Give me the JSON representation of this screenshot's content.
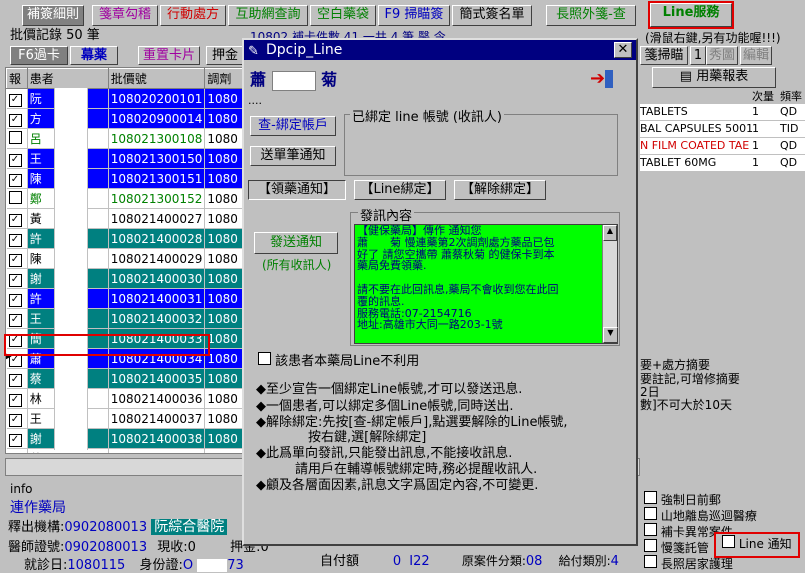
{
  "toolbar": {
    "b1": "補簽細則",
    "b2": "箋章勾稽",
    "b3": "行動處方",
    "b4": "互助網查詢",
    "b5": "空白藥袋",
    "b6": "F9 掃瞄簽",
    "b7": "簡式簽名單",
    "b8": "長照外箋-查",
    "b9": "Line服務"
  },
  "header": {
    "count_label": "批價記錄 50 筆",
    "top_clipped": "10802 補卡件數 41 一共 4 筆 醫 令"
  },
  "tabs": {
    "f6": "F6過卡",
    "sputum": "幕薬",
    "reprint": "重置卡片",
    "deposit": "押金"
  },
  "grid": {
    "columns": [
      "報",
      "患者",
      "批價號",
      "調劑"
    ],
    "rows": [
      {
        "name": "阮",
        "id": "108020200101",
        "adj": "1080",
        "style": "blue",
        "checked": "✓",
        "marker": ""
      },
      {
        "name": "方",
        "id": "108020900014",
        "adj": "1080",
        "style": "blue",
        "checked": "✓",
        "marker": ""
      },
      {
        "name": "呂　　水",
        "id": "108021300108",
        "adj": "1080",
        "style": "green",
        "checked": "",
        "marker": ""
      },
      {
        "name": "王",
        "id": "108021300150",
        "adj": "1080",
        "style": "blue",
        "checked": "✓",
        "marker": ""
      },
      {
        "name": "陳　　珠",
        "id": "108021300151",
        "adj": "1080",
        "style": "blue",
        "checked": "✓",
        "marker": ""
      },
      {
        "name": "鄭",
        "id": "108021300152",
        "adj": "1080",
        "style": "green",
        "checked": "",
        "marker": ""
      },
      {
        "name": "黃",
        "id": "108021400027",
        "adj": "1080",
        "style": "plain",
        "checked": "✓",
        "marker": ""
      },
      {
        "name": "許　　錦",
        "id": "108021400028",
        "adj": "1080",
        "style": "teal",
        "checked": "✓",
        "marker": ""
      },
      {
        "name": "陳",
        "id": "108021400029",
        "adj": "1080",
        "style": "plain",
        "checked": "✓",
        "marker": ""
      },
      {
        "name": "謝",
        "id": "108021400030",
        "adj": "1080",
        "style": "teal",
        "checked": "✓",
        "marker": ""
      },
      {
        "name": "許",
        "id": "108021400031",
        "adj": "1080",
        "style": "blue",
        "checked": "✓",
        "marker": ""
      },
      {
        "name": "王",
        "id": "108021400032",
        "adj": "1080",
        "style": "teal",
        "checked": "✓",
        "marker": ""
      },
      {
        "name": "簡",
        "id": "108021400033",
        "adj": "1080",
        "style": "teal",
        "checked": "✓",
        "marker": ""
      },
      {
        "name": "蕭　　菊",
        "id": "108021400034",
        "adj": "1080",
        "style": "blue",
        "checked": "✓",
        "marker": "▶"
      },
      {
        "name": "蔡",
        "id": "108021400035",
        "adj": "1080",
        "style": "teal",
        "checked": "✓",
        "marker": ""
      },
      {
        "name": "林",
        "id": "108021400036",
        "adj": "1080",
        "style": "plain",
        "checked": "✓",
        "marker": ""
      },
      {
        "name": "王",
        "id": "108021400037",
        "adj": "1080",
        "style": "plain",
        "checked": "✓",
        "marker": ""
      },
      {
        "name": "謝",
        "id": "108021400038",
        "adj": "1080",
        "style": "teal",
        "checked": "✓",
        "marker": ""
      },
      {
        "name": "黃",
        "id": "108021400039",
        "adj": "1080",
        "style": "plain",
        "checked": "✓",
        "marker": ""
      }
    ]
  },
  "dialog": {
    "title": "Dpcip_Line",
    "patient_surname": "蕭",
    "patient_given": "菊",
    "dots": "....",
    "bound_group": "已綁定 line 帳號 (收訊人)",
    "query_btn": "查-綁定帳戶",
    "send_each_btn": "送單筆通知",
    "tab_notify": "【領藥通知】",
    "tab_bind": "【Line綁定】",
    "tab_unbind": "【解除綁定】",
    "msg_group": "發訊內容",
    "send_btn": "發送通知",
    "send_sub": "(所有收訊人)",
    "msg_lines": [
      "【健保藥局】傳作 通知您",
      "蕭　　菊 慢連藥第2次調劑處方藥品已包",
      "好了 請您空攜帶 蕭蔡秋菊 的健保卡到本",
      "藥局免費領藥.",
      "",
      "請不要在此回訊息,藥局不會收到您在此回",
      "覆的訊息.",
      "服務電話:07-2154716",
      "地址:高雄市大同一路203-1號"
    ],
    "no_line_label": "該患者本藥局Line不利用",
    "notes": [
      "◆至少宣告一個綁定Line帳號,才可以發送迅息.",
      "◆一個患者,可以綁定多個Line帳號,同時送出.",
      "◆解除綁定:先按[查-綁定帳戶],點選要解除的Line帳號,",
      "　　　　按右鍵,選[解除綁定]",
      "◆此爲單向發訊,只能發出訊息,不能接收訊息.",
      "　　　請用戶在輔導帳號綁定時,務必提醒收訊人.",
      "◆顧及各層面因素,訊息文字爲固定內容,不可變更."
    ]
  },
  "right": {
    "hint": "(滑鼠右鍵,另有功能喔!!!)",
    "btn_scan": "箋掃瞄",
    "btn_1": "1",
    "btn_redo": "秀圖",
    "btn_edit": "編輯",
    "btn_report": "用藥報表",
    "col_qty": "次量",
    "col_freq": "頻率",
    "meds": [
      {
        "name": "TABLETS",
        "qty": "1",
        "freq": "QD"
      },
      {
        "name": "BAL CAPSULES 5001",
        "qty": "1",
        "freq": "TID"
      },
      {
        "name": "N FILM COATED TAE",
        "qty": "1",
        "freq": "QD"
      },
      {
        "name": "TABLET 60MG",
        "qty": "1",
        "freq": "QD"
      }
    ],
    "note1": "要+處方摘要",
    "note2": "要註記,可增修摘要",
    "note3": "2日",
    "note4": "數]不可大於10天",
    "chk1": "強制日前郵",
    "chk2": "山地離島巡迴醫療",
    "chk3": "補卡異常案件",
    "chk4": "慢箋託管",
    "chk5": "長照居家護理",
    "line_notify": "Line 通知"
  },
  "bottom": {
    "info": "info",
    "pharmacy": "連作藥局",
    "inst_label": "釋出機構:",
    "inst_code": "0902080013",
    "inst_name": "阮綜合醫院",
    "doc_label": "醫師證號:",
    "doc_code": "0902080013",
    "cash_label": "現收:",
    "cash_val": "0",
    "deposit_label": "押金:",
    "deposit_val": "0",
    "visit_label": "就診日:",
    "visit_val": "1080115",
    "id_label": "身份證:",
    "id_val": "O",
    "id_tail": "73",
    "self_pay_label": "自付額",
    "self_pay_val": "0",
    "code": "I22",
    "case_label": "原案件分類:",
    "case_val": "08",
    "pay_label": "給付類別:",
    "pay_val": "4"
  }
}
